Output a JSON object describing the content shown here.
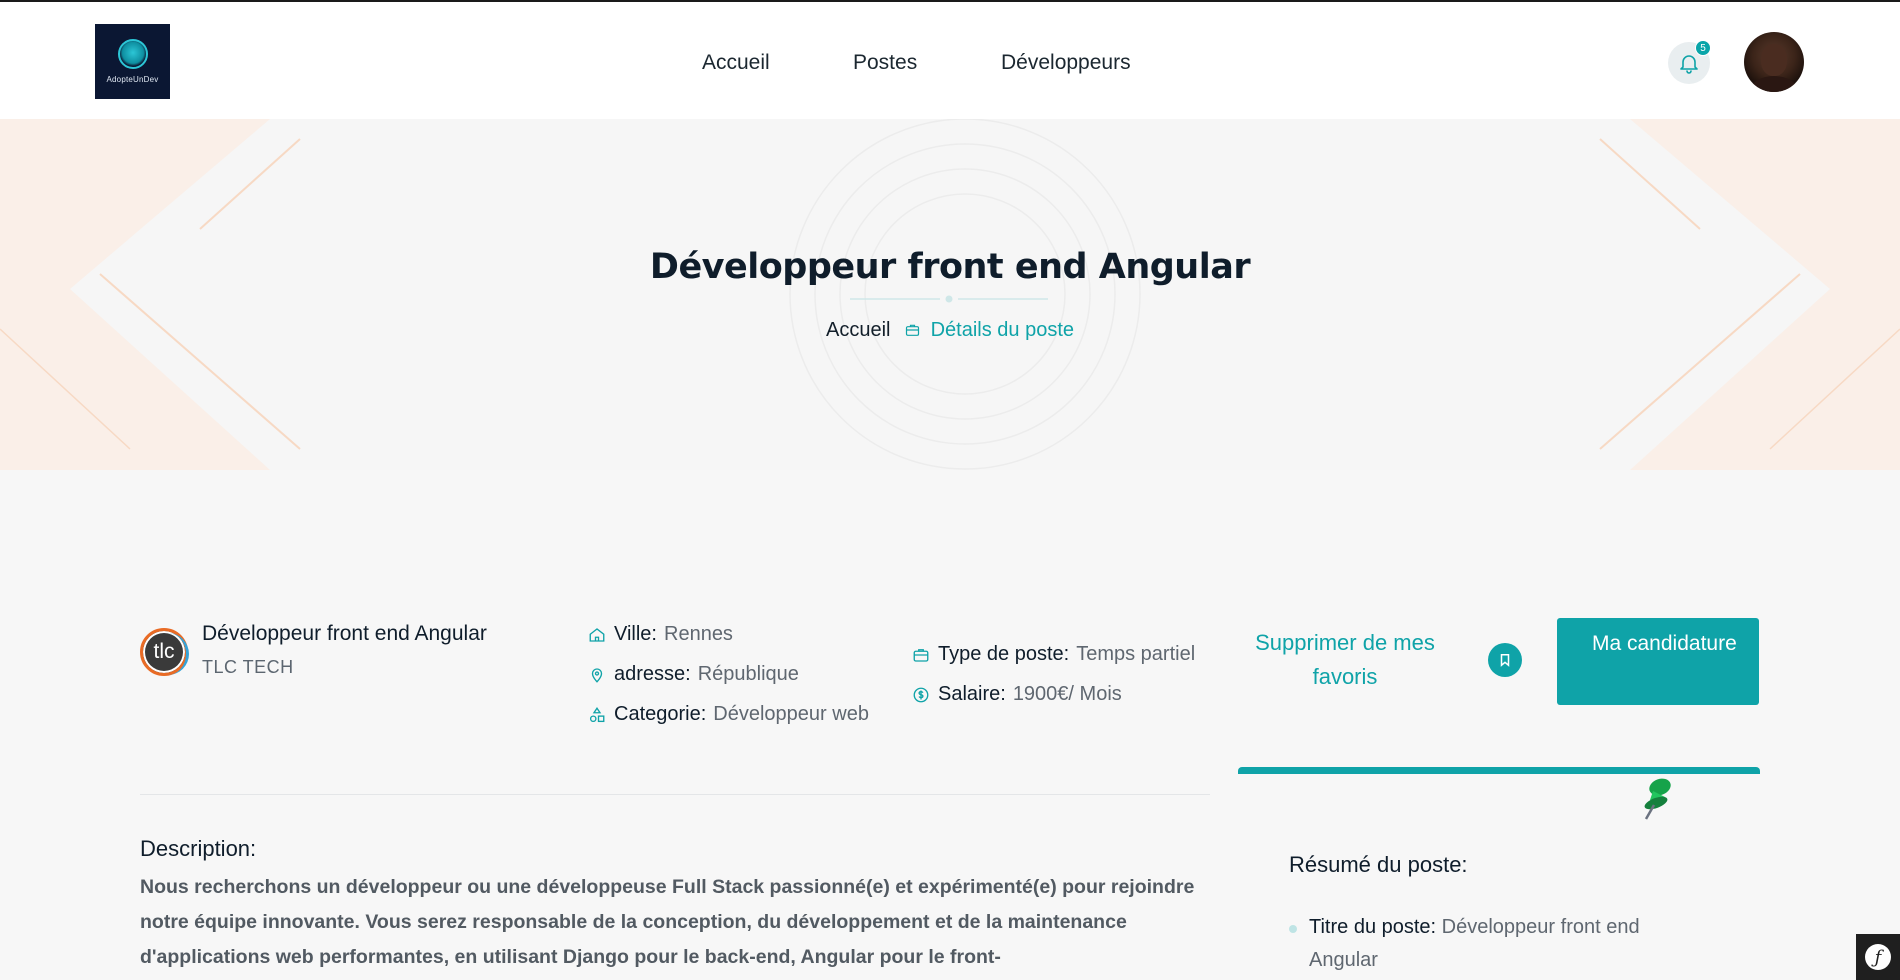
{
  "header": {
    "logo_text": "AdopteUnDev",
    "nav": [
      {
        "label": "Accueil"
      },
      {
        "label": "Postes"
      },
      {
        "label": "Développeurs"
      }
    ],
    "notifications_count": "5"
  },
  "hero": {
    "title": "Développeur front end Angular",
    "breadcrumb_home": "Accueil",
    "breadcrumb_current": "Détails du poste"
  },
  "job": {
    "company_logo_text": "tlc",
    "title": "Développeur front end Angular",
    "company": "TLC TECH",
    "ville_label": "Ville:",
    "ville": "Rennes",
    "adresse_label": "adresse:",
    "adresse": "République",
    "categorie_label": "Categorie:",
    "categorie": "Développeur web",
    "type_label": "Type de poste:",
    "type": "Temps partiel",
    "salaire_label": "Salaire:",
    "salaire": "1900€/ Mois",
    "remove_favorite": "Supprimer de mes favoris",
    "apply": "Ma candidature"
  },
  "description": {
    "heading": "Description:",
    "text": "Nous recherchons un développeur ou une développeuse Full Stack passionné(e) et expérimenté(e) pour rejoindre notre équipe innovante. Vous serez responsable de la conception, du développement et de la maintenance d'applications web performantes, en utilisant Django pour le back-end, Angular pour le front-"
  },
  "summary": {
    "heading": "Résumé du poste:",
    "title_label": "Titre du poste:",
    "title_value": "Développeur front end Angular"
  },
  "colors": {
    "accent": "#0fa3a8",
    "dark": "#0f1d2b"
  }
}
